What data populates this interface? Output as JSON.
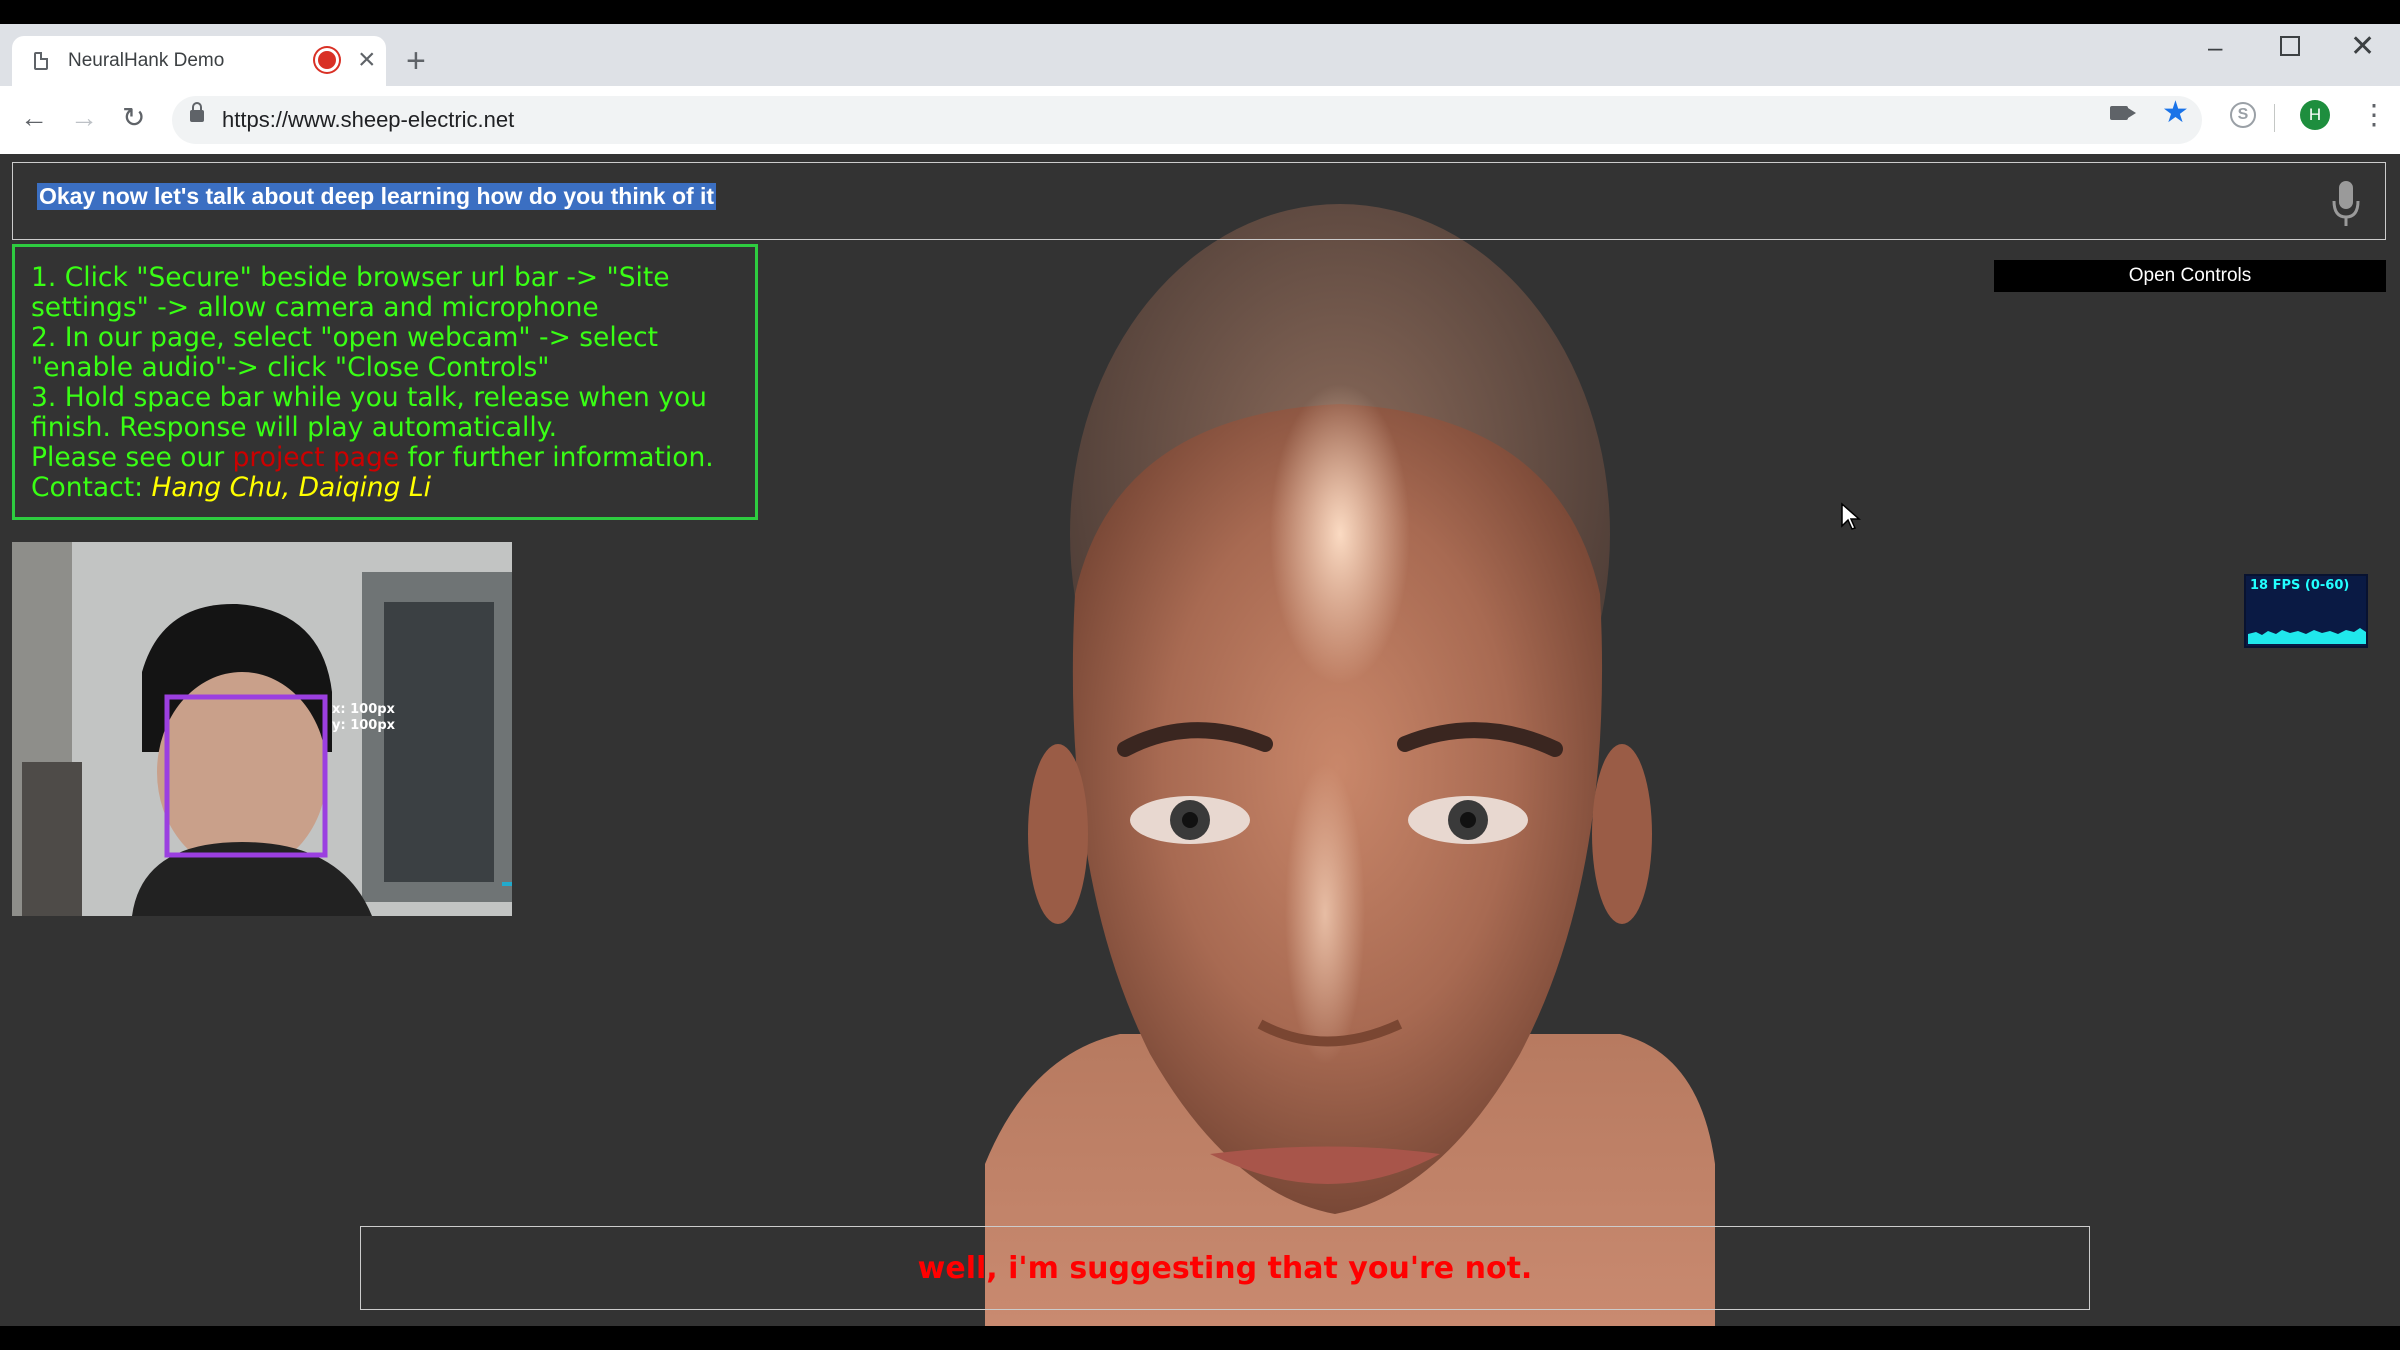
{
  "browser": {
    "tab_title": "NeuralHank Demo",
    "url": "https://www.sheep-electric.net",
    "profile_initial": "H",
    "skype_initial": "S"
  },
  "speech": {
    "transcript": "Okay now let's talk about deep learning how do you think of it"
  },
  "instructions": {
    "line1": "1. Click \"Secure\" beside browser url bar -> \"Site settings\" -> allow camera and microphone",
    "line2": "2. In our page, select \"open webcam\" -> select \"enable audio\"-> click \"Close Controls\"",
    "line3": "3. Hold space bar while you talk, release when you finish. Response will play automatically.",
    "see_prefix": "Please see our ",
    "see_link": "project page",
    "see_suffix": " for further information.",
    "contact_prefix": "Contact: ",
    "contact_names": "Hang Chu, Daiqing Li"
  },
  "controls": {
    "open_label": "Open Controls"
  },
  "webcam": {
    "coord_x": "x: 100px",
    "coord_y": "y: 100px"
  },
  "stats": {
    "fps_label": "18 FPS (0-60)"
  },
  "caption": {
    "text": "well, i'm suggesting that you're not."
  },
  "colors": {
    "instruction_text": "#39ff14",
    "instruction_border": "#2ecc40",
    "caption_text": "#ff0000",
    "contact_names": "#ffff00",
    "link": "#cc0000",
    "page_bg": "#333333"
  }
}
